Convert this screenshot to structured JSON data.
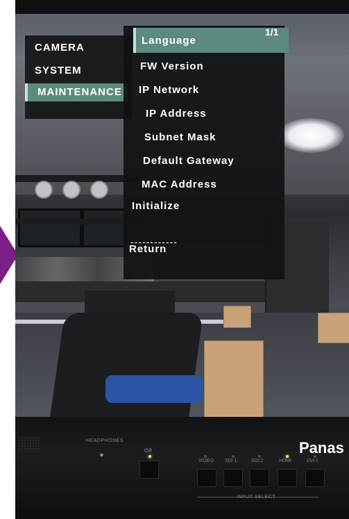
{
  "osd": {
    "page_indicator": "1/1",
    "left_menu": [
      {
        "label": "CAMERA",
        "selected": false
      },
      {
        "label": "SYSTEM",
        "selected": false
      },
      {
        "label": "MAINTENANCE",
        "selected": true
      }
    ],
    "right_menu": {
      "header": "Language",
      "items": [
        "FW Version",
        "IP Network",
        "IP Address",
        "Subnet Mask",
        "Default Gateway",
        "MAC Address",
        "Initialize"
      ],
      "separator": "------------",
      "return": "Return"
    }
  },
  "monitor": {
    "brand": "Panas",
    "headphones_label": "HEADPHONES",
    "power_label": "⏻/I",
    "inputs": [
      {
        "label": "VIDEO",
        "active": false
      },
      {
        "label": "SDI 1",
        "active": false
      },
      {
        "label": "SDI 2",
        "active": false
      },
      {
        "label": "HDMI",
        "active": true
      },
      {
        "label": "DVI-I",
        "active": false
      }
    ],
    "input_select_label": "INPUT SELECT"
  },
  "colors": {
    "highlight": "#5d8a80",
    "arrow": "#7a1f86",
    "led_on": "#f4e36a"
  }
}
